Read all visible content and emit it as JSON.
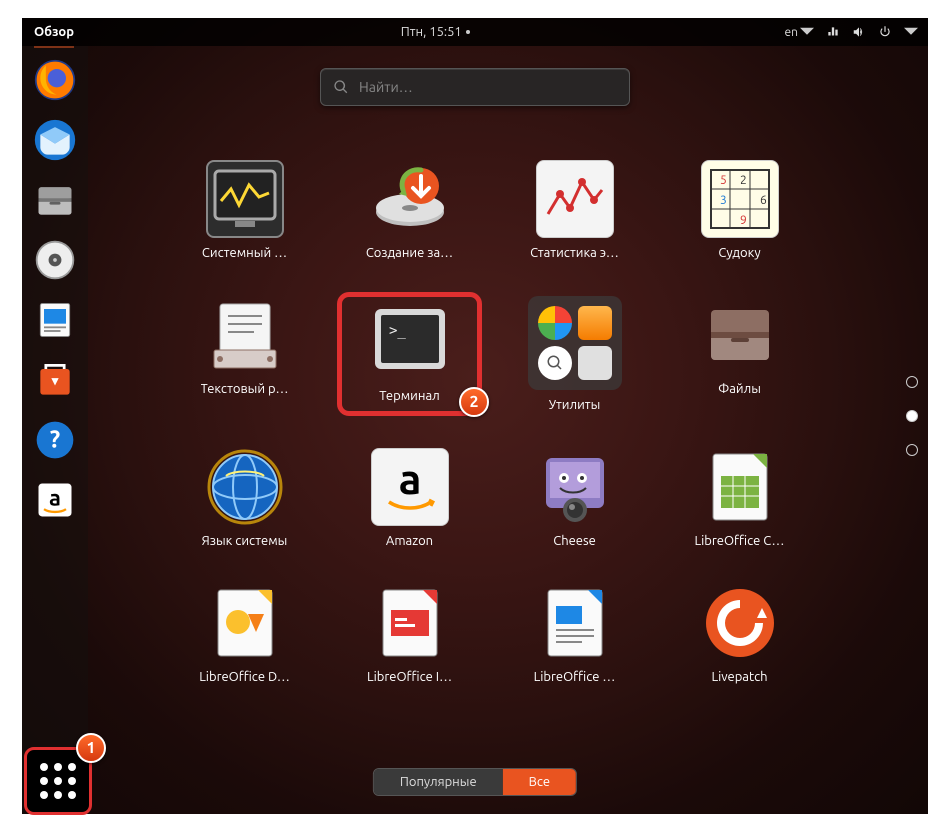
{
  "topbar": {
    "activities": "Обзор",
    "clock": "Птн, 15:51",
    "language": "en"
  },
  "search": {
    "placeholder": "Найти…"
  },
  "tabs": {
    "frequent": "Популярные",
    "all": "Все"
  },
  "apps": [
    {
      "label": "Системный …"
    },
    {
      "label": "Создание за…"
    },
    {
      "label": "Статистика э…"
    },
    {
      "label": "Судоку"
    },
    {
      "label": "Текстовый р…"
    },
    {
      "label": "Терминал"
    },
    {
      "label": "Утилиты"
    },
    {
      "label": "Файлы"
    },
    {
      "label": "Язык системы"
    },
    {
      "label": "Amazon"
    },
    {
      "label": "Cheese"
    },
    {
      "label": "LibreOffice C…"
    },
    {
      "label": "LibreOffice D…"
    },
    {
      "label": "LibreOffice I…"
    },
    {
      "label": "LibreOffice …"
    },
    {
      "label": "Livepatch"
    }
  ],
  "annotations": {
    "badge1": "1",
    "badge2": "2"
  },
  "dock_icons": [
    "firefox",
    "thunderbird",
    "files",
    "rhythmbox",
    "writer",
    "software",
    "help",
    "amazon"
  ]
}
